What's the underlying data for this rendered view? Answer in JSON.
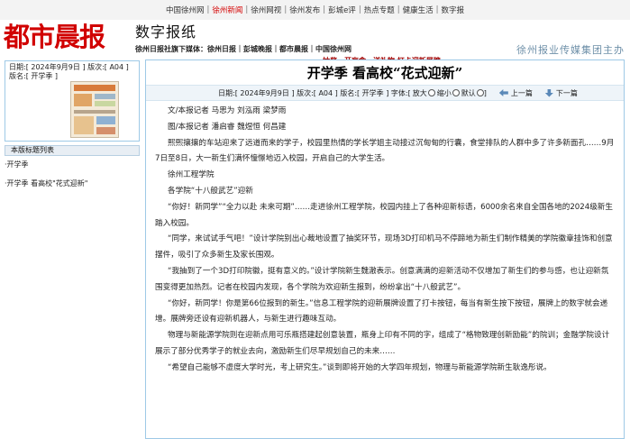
{
  "topnav": {
    "items": [
      "中国徐州网",
      "徐州新闻",
      "徐州网视",
      "徐州发布",
      "彭城e评",
      "热点专题",
      "健康生活",
      "数字报"
    ],
    "active_index": 1
  },
  "header": {
    "logo": "都市晨报",
    "product": "数字报纸",
    "subtitle": "徐州日报社旗下媒体：徐州日报｜彭城晚报｜都市晨报｜中国徐州网",
    "group": "徐州报业传媒集团主办",
    "ticker": "抽奖、开盲盒、送礼物 打卡迎新展牌……"
  },
  "sidebar": {
    "date_line": "日期:[ 2024年9月9日 ] 版次:[ A04 ]",
    "page_line": "版名:[ 开学季 ]",
    "list_header": "本版标题列表",
    "list_items": [
      "·开学季",
      "·开学季 看高校\"花式迎新\""
    ]
  },
  "article": {
    "title": "开学季 看高校“花式迎新”",
    "info_text": "日期:[ 2024年9月9日 ] 版次:[ A04 ] 版名:[ 开学季 ] 字体:[",
    "font_large": "放大",
    "font_small": "缩小",
    "font_default": "默认",
    "info_close": "]",
    "prev_label": "上一篇",
    "next_label": "下一篇",
    "paragraphs": [
      "文/本报记者 马思为 刘泓雨 梁梦雨",
      "图/本报记者 潘启睿 魏煜恒 何昌建",
      "熙熙攘攘的车站迎来了远道而来的学子，校园里热情的学长学姐主动接过沉甸甸的行囊，食堂排队的人群中多了许多新面孔……9月7日至8日，大一新生们满怀憧憬地迈入校园，开启自己的大学生活。",
      "徐州工程学院",
      "各学院“十八般武艺”迎新",
      "“你好！新同学”“全力以赴 未来可期”……走进徐州工程学院，校园内挂上了各种迎新标语，6000余名来自全国各地的2024级新生踏入校园。",
      "“同学，来试试手气吧！”设计学院别出心裁地设置了抽奖环节，现场3D打印机马不停蹄地为新生们制作精美的学院徽章挂饰和创意摆件，吸引了众多新生及家长围观。",
      "“我抽到了一个3D打印院徽，挺有意义的。”设计学院新生魏澈表示。创意满满的迎新活动不仅增加了新生们的参与感，也让迎新氛围变得更加热烈。记者在校园内发现，各个学院为欢迎新生报到，纷纷拿出“十八般武艺”。",
      "“你好，新同学！你是第66位报到的新生。”信息工程学院的迎新展牌设置了打卡按钮，每当有新生按下按钮，展牌上的数字就会递增。展牌旁还设有迎新机器人，与新生进行趣味互动。",
      "物理与新能源学院则在迎新点用可乐瓶搭建起创意装置，瓶身上印有不同的字，组成了“格物致理创新励能”的院训；金融学院设计展示了部分优秀学子的就业去向，激励新生们尽早规划自己的未来……",
      "“希望自己能够不虚度大学时光，考上研究生。”谈到即将开始的大学四年规划，物理与新能源学院新生耿逸彤说。"
    ]
  },
  "colors": {
    "brand_red": "#d10000",
    "nav_active": "#d40000",
    "frame_blue": "#9ec9e6",
    "group_text": "#6d8fa8"
  }
}
